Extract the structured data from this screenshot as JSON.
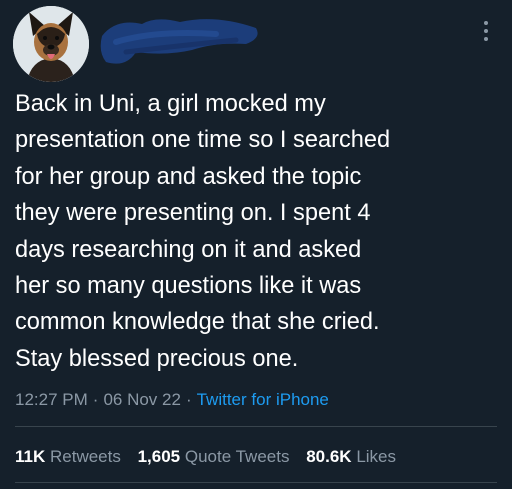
{
  "tweet": {
    "avatar_icon": "dog-avatar-icon",
    "username_redacted": true,
    "more_icon": "more-vertical-icon",
    "text_lines": [
      "Back in Uni, a girl mocked my",
      "presentation one time so I searched",
      "for her group and asked the topic",
      "they were presenting on. I spent 4",
      "days researching on it and asked",
      "her so many questions like it was",
      "common knowledge that she cried.",
      "Stay blessed precious one."
    ],
    "time": "12:27 PM",
    "separator": "·",
    "date": "06 Nov 22",
    "source": "Twitter for iPhone",
    "stats": {
      "retweets_count": "11K",
      "retweets_label": "Retweets",
      "quote_count": "1,605",
      "quote_label": "Quote Tweets",
      "likes_count": "80.6K",
      "likes_label": "Likes"
    }
  },
  "colors": {
    "background": "#15202b",
    "text": "#ffffff",
    "muted": "#8b98a5",
    "link": "#1d9bf0",
    "divider": "#38444d",
    "redaction": "#1c3d7a"
  }
}
